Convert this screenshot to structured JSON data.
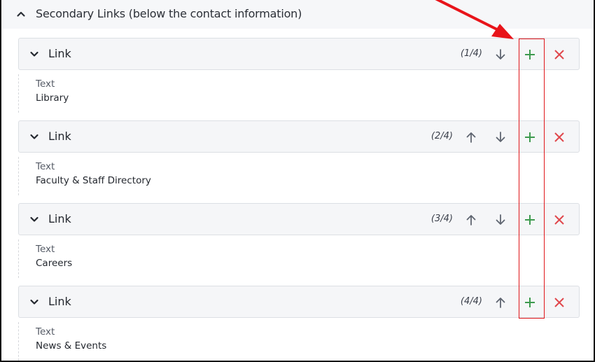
{
  "section": {
    "title": "Secondary Links (below the contact information)",
    "expanded": true
  },
  "items": [
    {
      "title": "Link",
      "counter": "(1/4)",
      "field_label": "Text",
      "field_value": "Library",
      "has_up": false,
      "has_down": true
    },
    {
      "title": "Link",
      "counter": "(2/4)",
      "field_label": "Text",
      "field_value": "Faculty & Staff Directory",
      "has_up": true,
      "has_down": true
    },
    {
      "title": "Link",
      "counter": "(3/4)",
      "field_label": "Text",
      "field_value": "Careers",
      "has_up": true,
      "has_down": true
    },
    {
      "title": "Link",
      "counter": "(4/4)",
      "field_label": "Text",
      "field_value": "News & Events",
      "has_up": true,
      "has_down": false
    }
  ],
  "icons": {
    "section_toggle": "chevron-up-icon",
    "item_toggle": "chevron-down-icon",
    "move_up": "arrow-up-icon",
    "move_down": "arrow-down-icon",
    "add": "plus-icon",
    "remove": "close-icon"
  },
  "colors": {
    "add": "#3d9a4e",
    "remove": "#e0474c",
    "move": "#5f6570",
    "annotation": "#e8141a"
  },
  "annotation": {
    "type": "arrow-and-box",
    "target": "add-buttons-column"
  }
}
